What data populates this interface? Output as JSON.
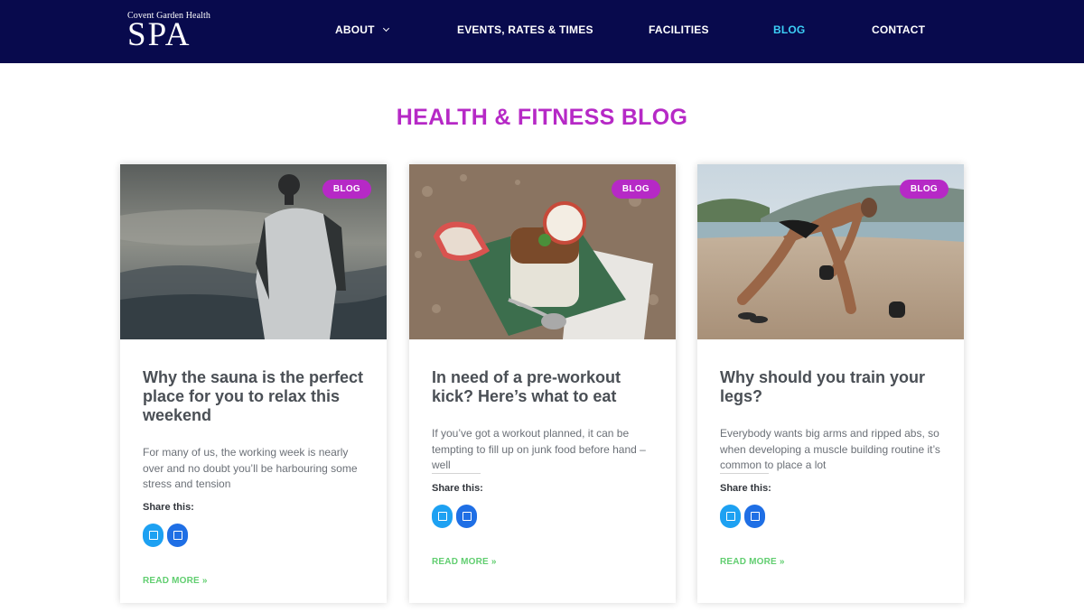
{
  "brand": {
    "small": "Covent Garden Health",
    "big": "SPA"
  },
  "nav": {
    "about": "ABOUT",
    "events": "EVENTS, RATES & TIMES",
    "facilities": "FACILITIES",
    "blog": "BLOG",
    "contact": "CONTACT"
  },
  "colors": {
    "header_bg": "#080a4d",
    "active_nav": "#3ccff6",
    "accent": "#b629c6",
    "read_more": "#61ce70"
  },
  "page_title": "HEALTH & FITNESS BLOG",
  "posts": [
    {
      "badge": "BLOG",
      "title": "Why the sauna is the perfect place for you to relax this weekend",
      "excerpt": "For many of us, the working week is nearly over and no doubt you’ll be harbouring some stress and tension",
      "share_label": "Share this:",
      "read_more": "READ MORE »"
    },
    {
      "badge": "BLOG",
      "title": "In need of a pre-workout kick? Here’s what to eat",
      "excerpt": "If you’ve got a workout planned, it can be tempting to fill up on junk food before hand – well",
      "share_label": "Share this:",
      "read_more": "READ MORE »"
    },
    {
      "badge": "BLOG",
      "title": "Why should you train your legs?",
      "excerpt": "Everybody wants big arms and ripped abs, so when developing a muscle building routine it’s common to place a lot",
      "share_label": "Share this:",
      "read_more": "READ MORE »"
    }
  ]
}
